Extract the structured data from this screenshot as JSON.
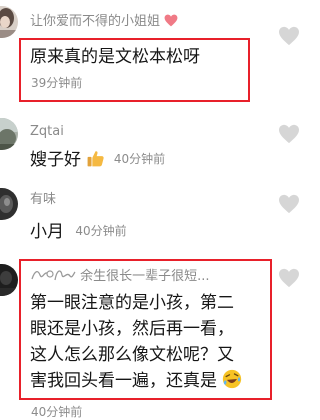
{
  "comments": [
    {
      "username": "让你爱而不得的小姐姐",
      "username_emoji": "heart",
      "text": "原来真的是文松本松呀",
      "time": "39分钟前",
      "highlighted": true
    },
    {
      "username": "Zqtai",
      "text": "嫂子好",
      "text_emoji": "thumbs-up",
      "time": "40分钟前",
      "highlighted": false
    },
    {
      "username": "有味",
      "text": "小月",
      "time": "40分钟前",
      "highlighted": false
    },
    {
      "username": "余生很长一辈子很短...",
      "username_prefix_icon": "decorative-signature",
      "text_lines": [
        "第一眼注意的是小孩，第二",
        "眼还是小孩，然后再一看，",
        "这人怎么那么像文松呢？又",
        "害我回头看一遍，还真是"
      ],
      "text_emoji": "rofl",
      "time": "40分钟前",
      "highlighted": true
    }
  ],
  "colors": {
    "highlight_border": "#e8202a",
    "username": "#8a8a8a",
    "content": "#161616",
    "time": "#8c8c8c",
    "like_icon": "#d6d6d6"
  }
}
